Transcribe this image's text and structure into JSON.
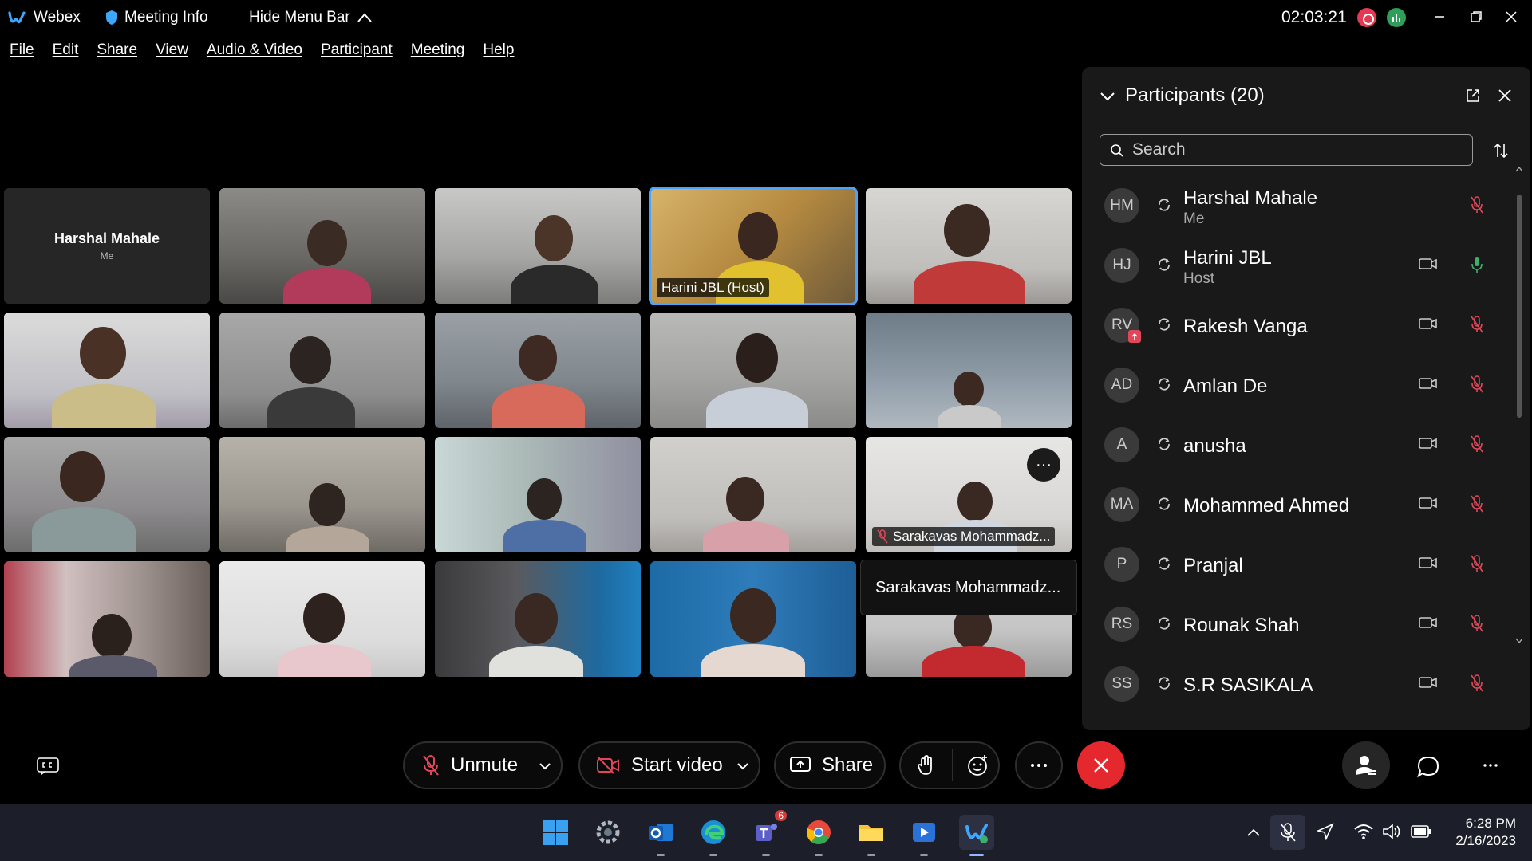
{
  "titlebar": {
    "app_name": "Webex",
    "meeting_info": "Meeting Info",
    "hide_menu_bar": "Hide Menu Bar",
    "timer": "02:03:21"
  },
  "menu": [
    "File",
    "Edit",
    "Share",
    "View",
    "Audio & Video",
    "Participant",
    "Meeting",
    "Help"
  ],
  "grid": {
    "me_name": "Harshal Mahale",
    "me_sub": "Me",
    "host_label": "Harini JBL (Host)",
    "muted_label": "Sarakavas Mohammadz...",
    "tooltip": "Sarakavas Mohammadz..."
  },
  "panel": {
    "title": "Participants (20)",
    "search_placeholder": "Search",
    "participants": [
      {
        "initials": "HM",
        "name": "Harshal Mahale",
        "role": "Me",
        "camera": false,
        "mic": "muted"
      },
      {
        "initials": "HJ",
        "name": "Harini JBL",
        "role": "Host",
        "camera": true,
        "mic": "active"
      },
      {
        "initials": "RV",
        "name": "Rakesh Vanga",
        "role": "",
        "camera": true,
        "mic": "muted"
      },
      {
        "initials": "AD",
        "name": "Amlan De",
        "role": "",
        "camera": true,
        "mic": "muted"
      },
      {
        "initials": "A",
        "name": "anusha",
        "role": "",
        "camera": true,
        "mic": "muted"
      },
      {
        "initials": "MA",
        "name": "Mohammed Ahmed",
        "role": "",
        "camera": true,
        "mic": "muted"
      },
      {
        "initials": "P",
        "name": "Pranjal",
        "role": "",
        "camera": true,
        "mic": "muted"
      },
      {
        "initials": "RS",
        "name": "Rounak Shah",
        "role": "",
        "camera": true,
        "mic": "muted"
      },
      {
        "initials": "SS",
        "name": "S.R SASIKALA",
        "role": "",
        "camera": true,
        "mic": "muted"
      }
    ]
  },
  "controls": {
    "unmute": "Unmute",
    "start_video": "Start video",
    "share": "Share"
  },
  "taskbar": {
    "teams_badge": "6",
    "time": "6:28 PM",
    "date": "2/16/2023"
  },
  "colors": {
    "accent": "#4aa3ff",
    "end_call": "#e5282e",
    "muted_icon": "#e0485a",
    "active_mic": "#3fb06c"
  }
}
